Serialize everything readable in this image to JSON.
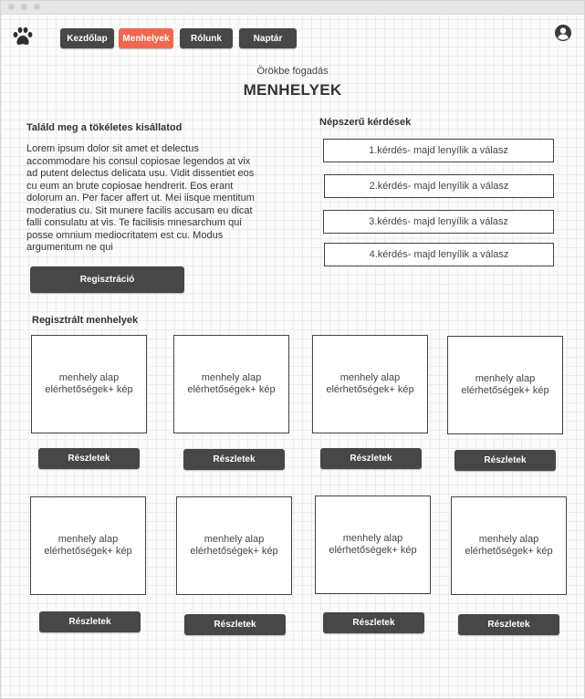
{
  "nav": {
    "logo_icon": "paw-icon",
    "items": [
      {
        "label": "Kezdőlap"
      },
      {
        "label": "Menhelyek",
        "active": true
      },
      {
        "label": "Rólunk"
      },
      {
        "label": "Naptár"
      }
    ],
    "user_icon": "user-icon"
  },
  "header": {
    "subtitle": "Örökbe fogadás",
    "title": "MENHELYEK"
  },
  "intro": {
    "heading": "Találd meg a tökéletes kisállatod",
    "text": "Lorem ipsum dolor sit amet et delectus accommodare his consul copiosae legendos at vix ad putent delectus delicata usu. Vidit dissentiet eos cu eum an brute copiosae hendrerit. Eos erant dolorum an. Per facer affert ut. Mei iisque mentitum moderatius cu. Sit munere facilis accusam eu dicat falli consulatu at vis. Te facilisis mnesarchum qui posse omnium mediocritatem est cu. Modus argumentum ne qui",
    "button": "Regisztráció"
  },
  "faq": {
    "heading": "Népszerű kérdések",
    "items": [
      "1.kérdés- majd lenyílik a válasz",
      "2.kérdés- majd lenyílik a válasz",
      "3.kérdés- majd lenyílik a válasz",
      "4.kérdés- majd lenyílik a válasz"
    ]
  },
  "shelters": {
    "heading": "Regisztrált menhelyek",
    "card_line1": "menhely alap",
    "card_line2": "elérhetőségek+ kép",
    "details_label": "Részletek"
  },
  "colors": {
    "accent": "#f0674f",
    "button": "#474747"
  }
}
